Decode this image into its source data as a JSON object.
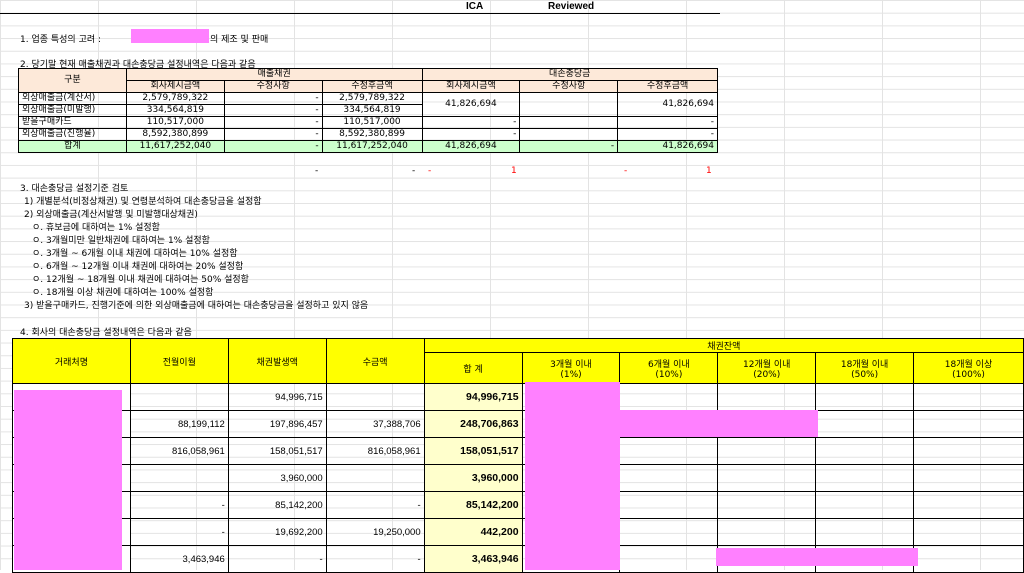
{
  "header": {
    "ica": "ICA",
    "reviewed": "Reviewed"
  },
  "section1": {
    "prefix": "1. 업종 특성의 고려 :",
    "suffix": "의 제조 및 판매"
  },
  "section2": {
    "title": "2. 당기말 현재 매출채권과 대손충당금 설정내역은 다음과 같음",
    "col_group": "구분",
    "group_receivable": "매출채권",
    "group_allowance": "대손충당금",
    "subheaders": [
      "회사제시금액",
      "수정사항",
      "수정후금액",
      "회사제시금액",
      "수정사항",
      "수정후금액"
    ],
    "rows": [
      {
        "label": "외상매출금(계산서)",
        "v": [
          "2,579,789,322",
          "-",
          "2,579,789,322"
        ]
      },
      {
        "label": "외상매출금(미발행)",
        "v": [
          "334,564,819",
          "-",
          "334,564,819"
        ]
      },
      {
        "label": "받을구매카드",
        "v": [
          "110,517,000",
          "-",
          "110,517,000"
        ],
        "a": [
          "-",
          "",
          "-"
        ]
      },
      {
        "label": "외상매출금(진행율)",
        "v": [
          "8,592,380,899",
          "-",
          "8,592,380,899"
        ],
        "a": [
          "-",
          "",
          "-"
        ]
      }
    ],
    "merged_allowance": [
      "41,826,694",
      "",
      "41,826,694"
    ],
    "total": {
      "label": "합계",
      "v": [
        "11,617,252,040",
        "-",
        "11,617,252,040",
        "41,826,694",
        "-",
        "41,826,694"
      ]
    },
    "check": [
      "-",
      "-",
      "-",
      "1",
      "-",
      "1"
    ]
  },
  "section3": {
    "title": "3. 대손충당금 설정기준 검토",
    "lines": [
      "1) 개별분석(비정상채권) 및 연령분석하여 대손충당금을 설정함",
      "2) 외상매출금(계산서발행 및 미발행대상채권)",
      "ㅇ. 휴보금에 대하여는 1% 설정함",
      "ㅇ. 3개월미만 일반채권에 대하여는 1% 설정함",
      "ㅇ. 3개월 ~ 6개월 이내 채권에 대하여는 10% 설정함",
      "ㅇ. 6개월 ~ 12개월 이내 채권에 대하여는 20% 설정함",
      "ㅇ. 12개월 ~ 18개월 이내 채권에 대하여는 50% 설정함",
      "ㅇ. 18개월 이상 채권에 대하여는 100% 설정함",
      "3) 받을구매카드, 진행기준에 의한 외상매출금에 대하여는 대손충당금을 설정하고 있지 않음"
    ]
  },
  "section4": {
    "title": "4. 회사의 대손충당금 설정내역은 다음과 같음",
    "headers": [
      "거래처명",
      "전월이월",
      "채권발생액",
      "수금액"
    ],
    "balance_group": "채권잔액",
    "sum_header": "합 계",
    "aging": [
      "3개월 이내\n(1%)",
      "6개월 이내\n(10%)",
      "12개월 이내\n(20%)",
      "18개월 이내\n(50%)",
      "18개월 이상\n(100%)"
    ],
    "rows": [
      [
        "",
        "94,996,715",
        "",
        "94,996,715"
      ],
      [
        "88,199,112",
        "197,896,457",
        "37,388,706",
        "248,706,863"
      ],
      [
        "816,058,961",
        "158,051,517",
        "816,058,961",
        "158,051,517"
      ],
      [
        "",
        "3,960,000",
        "",
        "3,960,000"
      ],
      [
        "-",
        "85,142,200",
        "-",
        "85,142,200"
      ],
      [
        "-",
        "19,692,200",
        "19,250,000",
        "442,200"
      ],
      [
        "3,463,946",
        "-",
        "-",
        "3,463,946"
      ]
    ]
  }
}
